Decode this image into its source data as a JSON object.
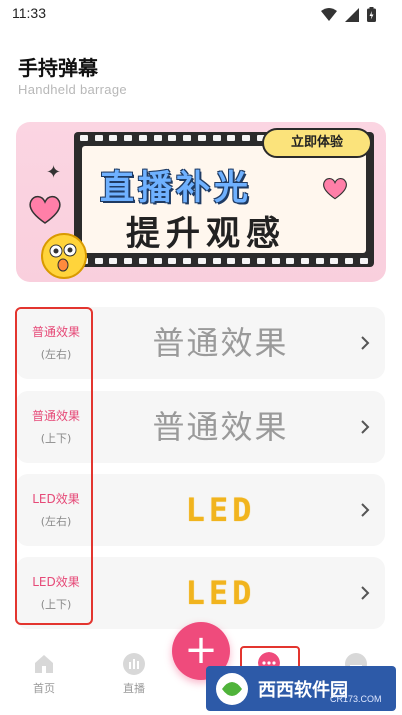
{
  "status_bar": {
    "time": "11:33",
    "icons": [
      "wifi-icon",
      "signal-icon",
      "battery-icon"
    ]
  },
  "header": {
    "title": "手持弹幕",
    "subtitle": "Handheld barrage"
  },
  "banner": {
    "line1": "直播补光",
    "line2": "提升观感",
    "cta": "立即体验"
  },
  "effects": [
    {
      "label": "普通效果",
      "direction": "(左右)",
      "preview": "普通效果",
      "style": "normal"
    },
    {
      "label": "普通效果",
      "direction": "(上下)",
      "preview": "普通效果",
      "style": "normal"
    },
    {
      "label": "LED效果",
      "direction": "(左右)",
      "preview": "LED",
      "style": "led"
    },
    {
      "label": "LED效果",
      "direction": "(上下)",
      "preview": "LED",
      "style": "led"
    }
  ],
  "bottom_nav": {
    "items": [
      {
        "label": "首页",
        "icon": "home-icon"
      },
      {
        "label": "直播",
        "icon": "live-icon"
      },
      {
        "label": "",
        "icon": "more-icon"
      },
      {
        "label": "",
        "icon": "profile-icon"
      }
    ],
    "fab": "+"
  },
  "watermark": {
    "text": "西西软件园",
    "sub": "CR173.COM"
  },
  "colors": {
    "accent": "#ef4b7c",
    "led": "#f1b41e",
    "highlight": "#e3352f",
    "label_pink": "#e64a78"
  }
}
